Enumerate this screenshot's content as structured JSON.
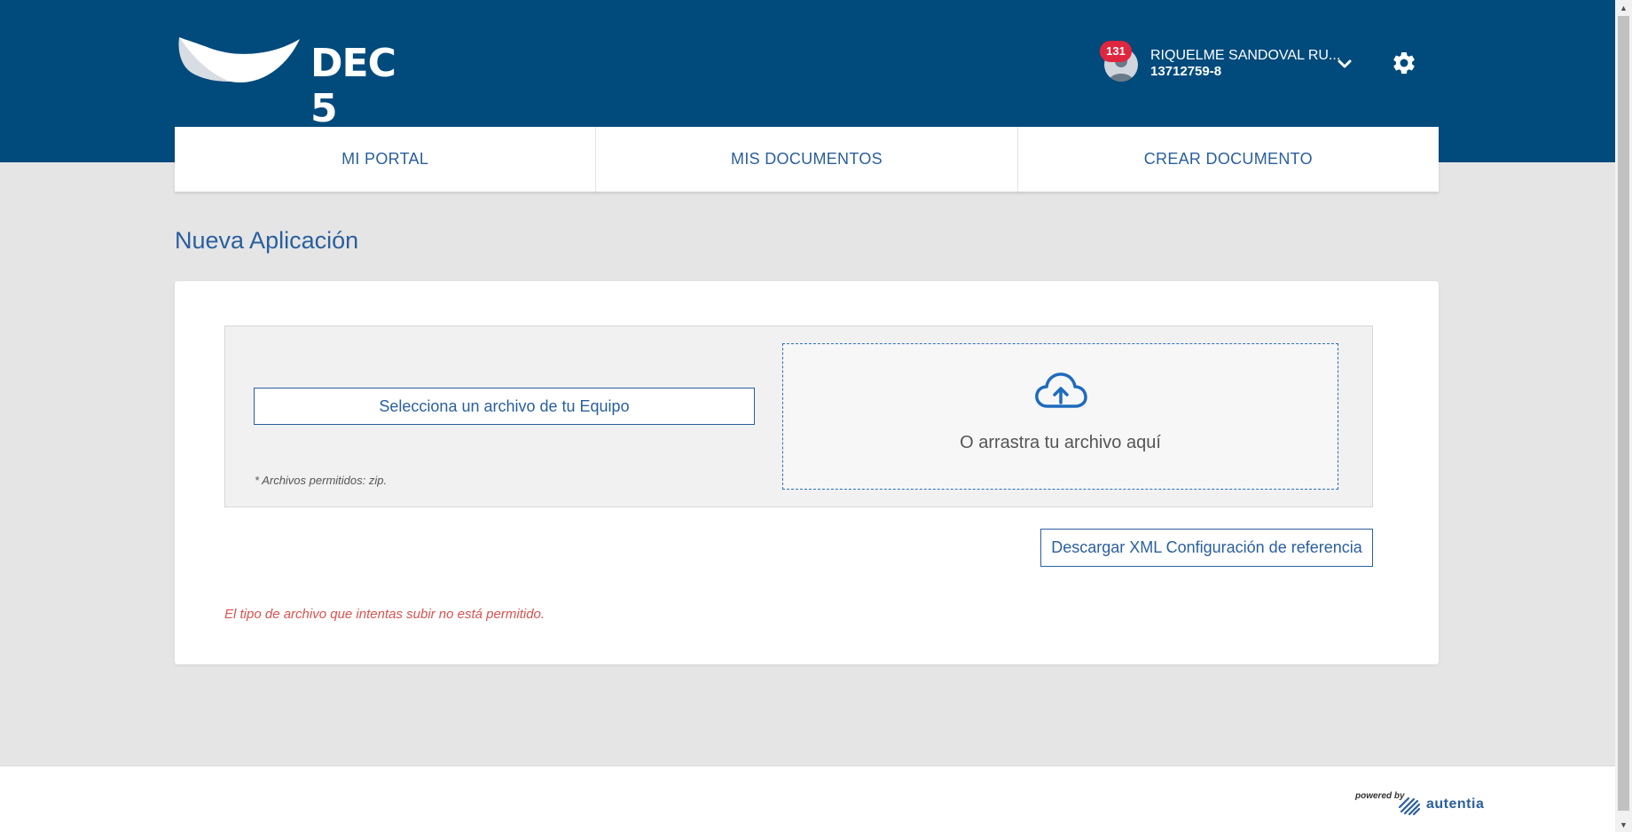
{
  "brand": {
    "name": "DEC 5"
  },
  "user": {
    "notification_count": "131",
    "name": "RIQUELME SANDOVAL RU...",
    "id": "13712759-8"
  },
  "nav": {
    "tabs": [
      {
        "label": "MI PORTAL"
      },
      {
        "label": "MIS DOCUMENTOS"
      },
      {
        "label": "CREAR DOCUMENTO"
      }
    ]
  },
  "page": {
    "title": "Nueva Aplicación"
  },
  "upload": {
    "select_button_label": "Selecciona un archivo de tu Equipo",
    "allowed_note": "* Archivos permitidos: zip.",
    "drop_text": "O arrastra tu archivo aquí",
    "download_xml_label": "Descargar XML Configuración de referencia",
    "error_message": "El tipo de archivo que intentas subir no está permitido."
  },
  "footer": {
    "powered_by": "powered by",
    "vendor": "autentia"
  },
  "colors": {
    "header_bg": "#004a7c",
    "accent": "#2a5f9e",
    "badge": "#e0263f",
    "error": "#d9534f",
    "page_bg": "#e5e5e5"
  },
  "icons": [
    "user-avatar-icon",
    "chevron-down-icon",
    "gear-icon",
    "cloud-upload-icon",
    "autentia-logo-icon"
  ]
}
